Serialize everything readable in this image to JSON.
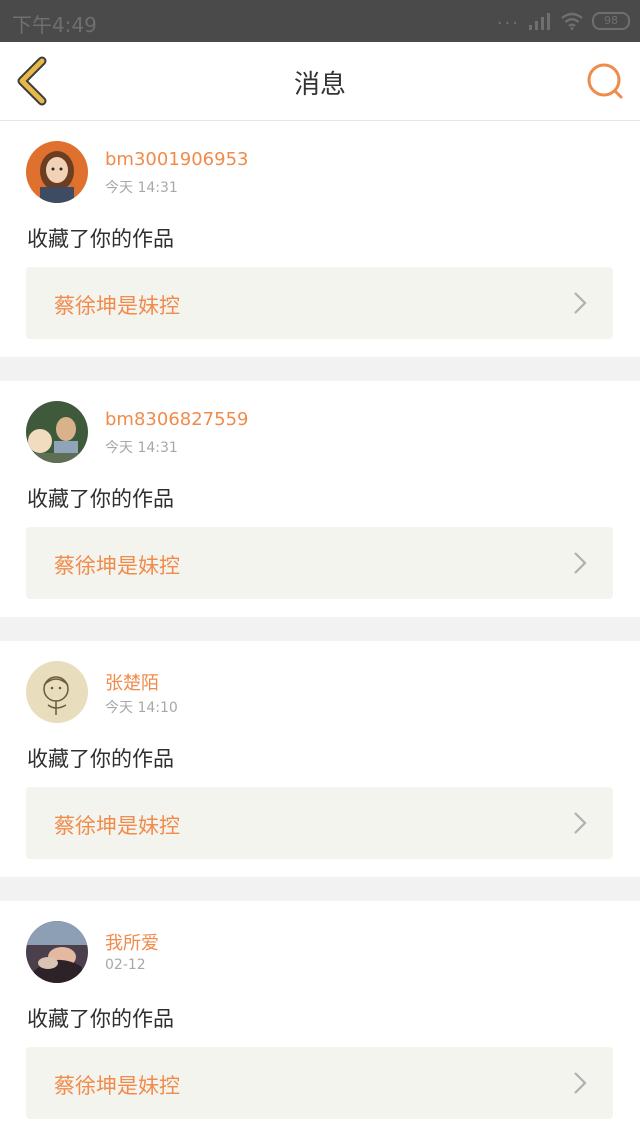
{
  "status_bar": {
    "time": "下午4:49",
    "signal_dots": "...",
    "battery": "98"
  },
  "header": {
    "title": "消息",
    "back_icon": "chevron-left-icon",
    "search_icon": "search-icon"
  },
  "colors": {
    "accent": "#f08b4b",
    "back_arrow": "#e8b94a",
    "card_bg": "#f4f4ef",
    "separator": "#f2f2f2"
  },
  "messages": [
    {
      "username": "bm3001906953",
      "time": "今天 14:31",
      "action": "收藏了你的作品",
      "work_title": "蔡徐坤是妹控"
    },
    {
      "username": "bm8306827559",
      "time": "今天 14:31",
      "action": "收藏了你的作品",
      "work_title": "蔡徐坤是妹控"
    },
    {
      "username": "张楚陌",
      "time": "今天 14:10",
      "action": "收藏了你的作品",
      "work_title": "蔡徐坤是妹控"
    },
    {
      "username": "我所爱",
      "time": "02-12",
      "action": "收藏了你的作品",
      "work_title": "蔡徐坤是妹控"
    }
  ]
}
